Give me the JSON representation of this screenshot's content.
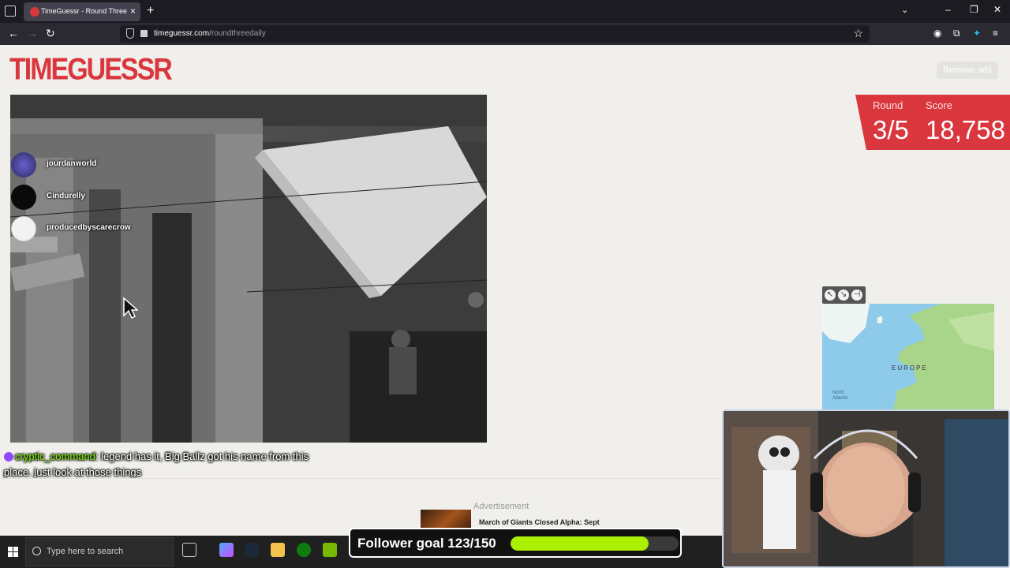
{
  "browser": {
    "tab_title": "TimeGuessr - Round Three",
    "url_domain": "timeguessr.com",
    "url_path": "/roundthreedaily"
  },
  "page": {
    "logo_text": "TIMEGUESSR",
    "remove_ads_label": "Remove ads",
    "round_label": "Round",
    "score_label": "Score",
    "round_value": "3/5",
    "score_value": "18,758",
    "map_label_region": "EUROPE",
    "map_label_ocean_line1": "North",
    "map_label_ocean_line2": "Atlantic",
    "ad_label": "Advertisement",
    "ad_title": "March of Giants Closed Alpha: Sept"
  },
  "overlay": {
    "socials": [
      {
        "name": "jourdanworld"
      },
      {
        "name": "Cindurelly"
      },
      {
        "name": "producedbyscarecrow"
      }
    ],
    "chat": {
      "user": "cryptic_command",
      "message": "legend has it, Big Ballz got his name from this place. just look at those things"
    },
    "follower_goal": {
      "label": "Follower goal 123/150",
      "current": 123,
      "goal": 150
    }
  },
  "taskbar": {
    "search_placeholder": "Type here to search"
  },
  "colors": {
    "brand_red": "#d9363e",
    "progress_green": "#aaf000",
    "page_bg": "#f0efeb"
  }
}
